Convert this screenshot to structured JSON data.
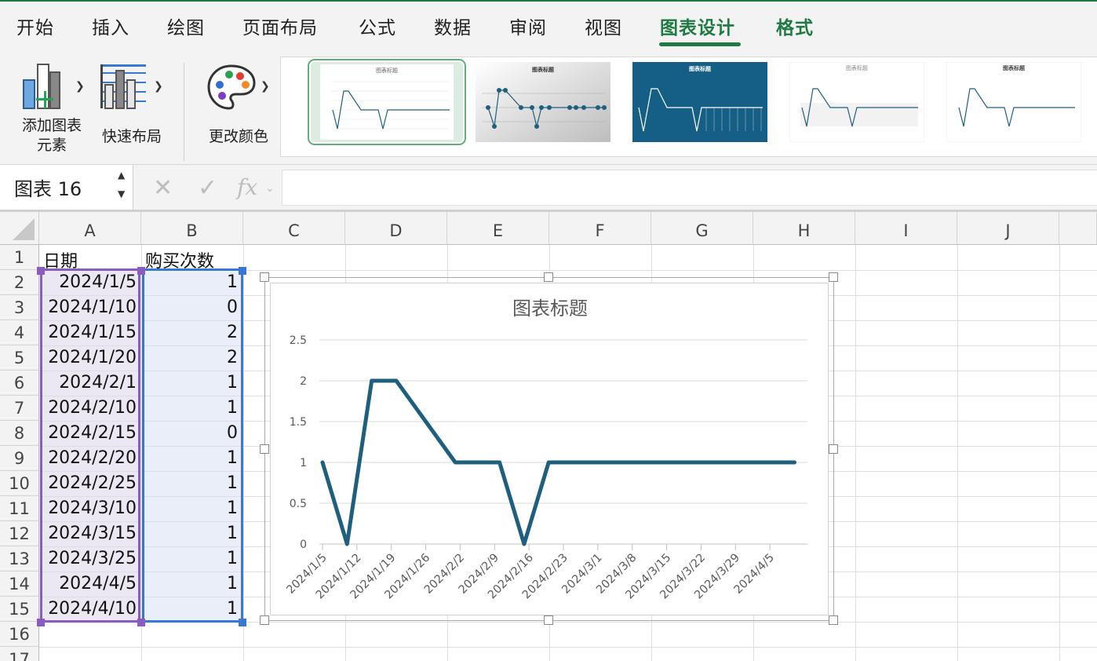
{
  "ribbon_tabs": [
    {
      "label": "开始"
    },
    {
      "label": "插入"
    },
    {
      "label": "绘图"
    },
    {
      "label": "页面布局"
    },
    {
      "label": "公式"
    },
    {
      "label": "数据"
    },
    {
      "label": "审阅"
    },
    {
      "label": "视图"
    },
    {
      "label": "图表设计",
      "active": true
    },
    {
      "label": "格式",
      "contextual": true
    }
  ],
  "ribbon": {
    "add_element_line1": "添加图表",
    "add_element_line2": "元素",
    "quick_layout": "快速布局",
    "change_colors": "更改颜色",
    "selected_style_index": 0
  },
  "formula_bar": {
    "name_box": "图表 16",
    "cancel_icon": "close-icon",
    "enter_icon": "check-icon",
    "fx_label": "fx",
    "formula": ""
  },
  "grid": {
    "columns": [
      "A",
      "B",
      "C",
      "D",
      "E",
      "F",
      "G",
      "H",
      "I",
      "J"
    ],
    "rows": [
      "1",
      "2",
      "3",
      "4",
      "5",
      "6",
      "7",
      "8",
      "9",
      "10",
      "11",
      "12",
      "13",
      "14",
      "15",
      "16",
      "17"
    ],
    "header_row": {
      "A": "日期",
      "B": "购买次数"
    },
    "data": [
      {
        "date": "2024/1/5",
        "count": "1"
      },
      {
        "date": "2024/1/10",
        "count": "0"
      },
      {
        "date": "2024/1/15",
        "count": "2"
      },
      {
        "date": "2024/1/20",
        "count": "2"
      },
      {
        "date": "2024/2/1",
        "count": "1"
      },
      {
        "date": "2024/2/10",
        "count": "1"
      },
      {
        "date": "2024/2/15",
        "count": "0"
      },
      {
        "date": "2024/2/20",
        "count": "1"
      },
      {
        "date": "2024/2/25",
        "count": "1"
      },
      {
        "date": "2024/3/10",
        "count": "1"
      },
      {
        "date": "2024/3/15",
        "count": "1"
      },
      {
        "date": "2024/3/25",
        "count": "1"
      },
      {
        "date": "2024/4/5",
        "count": "1"
      },
      {
        "date": "2024/4/10",
        "count": "1"
      }
    ],
    "selection_colors": {
      "dates": "#8a5cbf",
      "values": "#3a78d0"
    }
  },
  "chart_data": {
    "type": "line",
    "title": "图表标题",
    "xlabel": "",
    "ylabel": "",
    "x_axis_type": "date",
    "x": [
      "2024/1/5",
      "2024/1/10",
      "2024/1/15",
      "2024/1/20",
      "2024/2/1",
      "2024/2/10",
      "2024/2/15",
      "2024/2/20",
      "2024/2/25",
      "2024/3/10",
      "2024/3/15",
      "2024/3/25",
      "2024/4/5",
      "2024/4/10"
    ],
    "series": [
      {
        "values": [
          1,
          0,
          2,
          2,
          1,
          1,
          0,
          1,
          1,
          1,
          1,
          1,
          1,
          1
        ],
        "color": "#1f5f7e"
      }
    ],
    "xtick_labels": [
      "2024/1/5",
      "2024/1/12",
      "2024/1/19",
      "2024/1/26",
      "2024/2/2",
      "2024/2/9",
      "2024/2/16",
      "2024/2/23",
      "2024/3/1",
      "2024/3/8",
      "2024/3/15",
      "2024/3/22",
      "2024/3/29",
      "2024/4/5"
    ],
    "ytick_labels": [
      "0",
      "0.5",
      "1",
      "1.5",
      "2",
      "2.5"
    ],
    "ylim": [
      0,
      2.5
    ],
    "xlim": [
      "2024/1/5",
      "2024/4/12"
    ],
    "grid": true,
    "legend": false
  }
}
